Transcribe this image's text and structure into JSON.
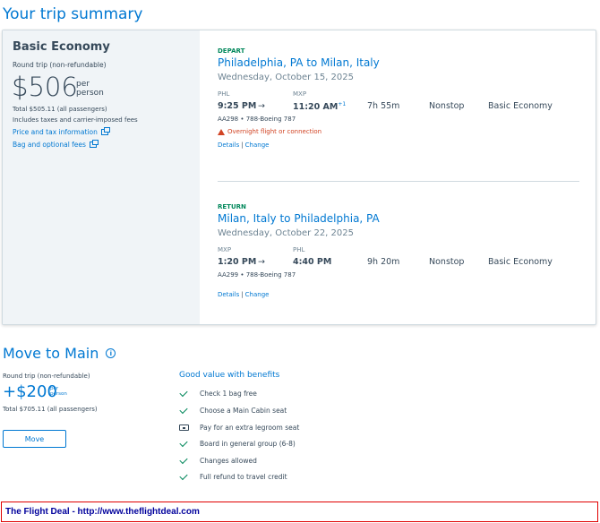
{
  "page": {
    "title": "Your trip summary"
  },
  "fare": {
    "name": "Basic Economy",
    "type": "Round trip (non-refundable)",
    "price": "$506",
    "per": "per",
    "person": "person",
    "total": "Total $505.11 (all passengers)",
    "taxes": "Includes taxes and carrier-imposed fees",
    "price_tax_link": "Price and tax information",
    "bag_link": "Bag and optional fees"
  },
  "depart": {
    "label": "DEPART",
    "route": "Philadelphia, PA to Milan, Italy",
    "date": "Wednesday, October 15, 2025",
    "origin_code": "PHL",
    "dest_code": "MXP",
    "depart_time": "9:25 PM",
    "arrow": "→",
    "arrive_time": "11:20 AM",
    "plus_day": "+1",
    "duration": "7h 55m",
    "stops": "Nonstop",
    "cabin": "Basic Economy",
    "flight": "AA298 • 788-Boeing 787",
    "warning": "Overnight flight or connection",
    "details": "Details",
    "sep": "|",
    "change": "Change"
  },
  "return": {
    "label": "RETURN",
    "route": "Milan, Italy to Philadelphia, PA",
    "date": "Wednesday, October 22, 2025",
    "origin_code": "MXP",
    "dest_code": "PHL",
    "depart_time": "1:20 PM",
    "arrow": "→",
    "arrive_time": "4:40 PM",
    "duration": "9h 20m",
    "stops": "Nonstop",
    "cabin": "Basic Economy",
    "flight": "AA299 • 788-Boeing 787",
    "details": "Details",
    "sep": "|",
    "change": "Change"
  },
  "upgrade": {
    "title": "Move to Main",
    "info_glyph": "i",
    "type": "Round trip (non-refundable)",
    "price": "+$200",
    "per": "per",
    "person": "person",
    "total": "Total $705.11 (all passengers)",
    "button": "Move",
    "benefits_title": "Good value with benefits",
    "benefits": [
      {
        "icon": "check-icon",
        "text": "Check 1 bag free"
      },
      {
        "icon": "check-icon",
        "text": "Choose a Main Cabin seat"
      },
      {
        "icon": "seat-icon",
        "text": "Pay for an extra legroom seat"
      },
      {
        "icon": "check-icon",
        "text": "Board in general group (6-8)"
      },
      {
        "icon": "check-icon",
        "text": "Changes allowed"
      },
      {
        "icon": "check-icon",
        "text": "Full refund to travel credit"
      }
    ]
  },
  "footer": {
    "text": "The Flight Deal - http://www.theflightdeal.com"
  },
  "colors": {
    "accent": "#0078d2",
    "success": "#00875a",
    "warning": "#d14424",
    "footer_border": "#e00000"
  }
}
